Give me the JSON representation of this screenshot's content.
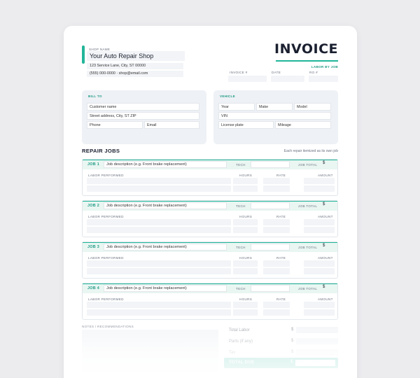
{
  "header": {
    "shop_name_label": "SHOP NAME",
    "shop_name": "Your Auto Repair Shop",
    "address": "123 Service Lane, City, ST 00000",
    "contact": "(555) 000-0000 · shop@email.com",
    "title": "INVOICE",
    "subtitle": "LABOR BY JOB",
    "invoice_no_label": "INVOICE #",
    "date_label": "DATE",
    "ro_label": "RO #"
  },
  "bill_to": {
    "label": "BILL TO",
    "customer_name": "Customer name",
    "street": "Street address, City, ST ZIP",
    "phone": "Phone",
    "email": "Email"
  },
  "vehicle": {
    "label": "VEHICLE",
    "year": "Year",
    "make": "Make",
    "model": "Model",
    "vin": "VIN",
    "plate": "License plate",
    "mileage": "Mileage"
  },
  "repair_jobs": {
    "title": "REPAIR JOBS",
    "note": "Each repair itemized as its own job",
    "tech_label": "TECH",
    "job_total_label": "JOB TOTAL",
    "currency": "$",
    "col_labor": "LABOR PERFORMED",
    "col_hours": "HOURS",
    "col_rate": "RATE",
    "col_amount": "AMOUNT",
    "jobs": [
      {
        "label": "JOB 1",
        "description": "Job description (e.g. Front brake replacement)"
      },
      {
        "label": "JOB 2",
        "description": "Job description (e.g. Front brake replacement)"
      },
      {
        "label": "JOB 3",
        "description": "Job description (e.g. Front brake replacement)"
      },
      {
        "label": "JOB 4",
        "description": "Job description (e.g. Front brake replacement)"
      }
    ]
  },
  "notes_label": "NOTES / RECOMMENDATIONS",
  "totals": {
    "total_labor": "Total Labor",
    "parts": "Parts (if any)",
    "tax": "Tax",
    "total_due": "TOTAL DUE",
    "currency": "$"
  },
  "colors": {
    "accent": "#22b59a",
    "panel": "#eef1f5",
    "background": "#ececef"
  }
}
